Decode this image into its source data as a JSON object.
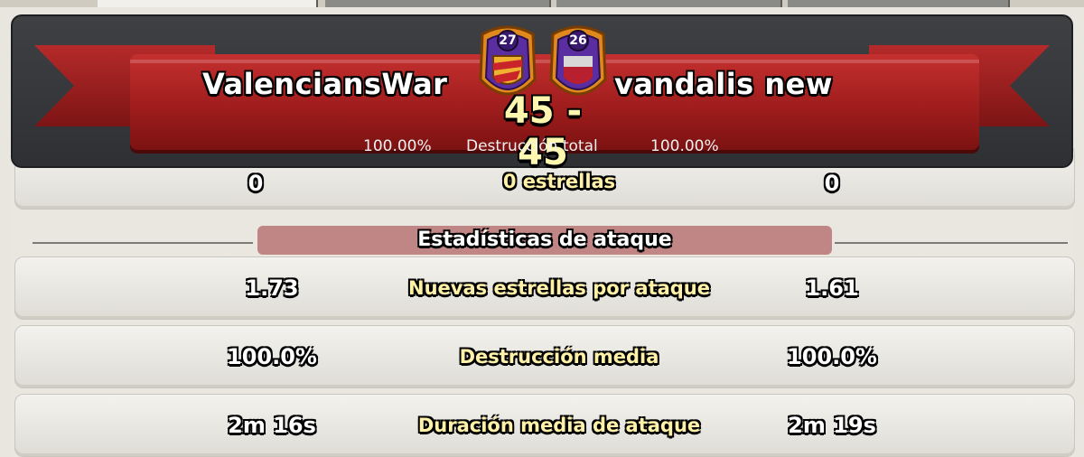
{
  "header": {
    "left_clan": {
      "name": "ValenciansWar",
      "level": "27",
      "destruction": "100.00%"
    },
    "right_clan": {
      "name": "vandalis new",
      "level": "26",
      "destruction": "100.00%"
    },
    "score": "45 - 45",
    "destruction_label": "Destrucción total"
  },
  "stars_row": {
    "left": "0",
    "label": "0 estrellas",
    "right": "0"
  },
  "attack_stats": {
    "title": "Estadísticas de ataque",
    "rows": [
      {
        "left": "1.73",
        "label": "Nuevas estrellas por ataque",
        "right": "1.61"
      },
      {
        "left": "100.0%",
        "label": "Destrucción media",
        "right": "100.0%"
      },
      {
        "left": "2m 16s",
        "label": "Duración media de ataque",
        "right": "2m 19s"
      }
    ]
  },
  "colors": {
    "ribbon": "#a01d1d",
    "header_bg": "#3a3b3e",
    "section_title_bg": "#c08585",
    "label_text": "#fff2a8"
  }
}
